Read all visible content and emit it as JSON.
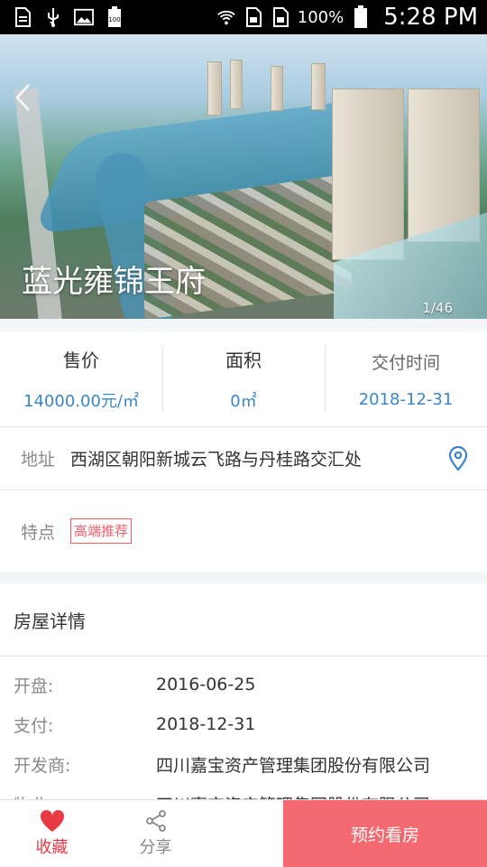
{
  "status_bar": {
    "battery_pct": "100%",
    "time": "5:28 PM",
    "battery_badge": "100",
    "icons": [
      "sim-card-icon",
      "usb-icon",
      "image-icon",
      "battery-icon",
      "wifi-icon",
      "sim-icon",
      "sim-icon",
      "battery-icon"
    ]
  },
  "hero": {
    "title": "蓝光雍锦王府",
    "counter": "1/46"
  },
  "stats": [
    {
      "label": "售价",
      "value": "14000.00元/㎡"
    },
    {
      "label": "面积",
      "value": "0㎡"
    },
    {
      "label": "交付时间",
      "value": "2018-12-31"
    }
  ],
  "address": {
    "label": "地址",
    "value": "西湖区朝阳新城云飞路与丹桂路交汇处"
  },
  "features": {
    "label": "特点",
    "tag": "高端推荐"
  },
  "details": {
    "title": "房屋详情",
    "rows": [
      {
        "label": "开盘:",
        "value": "2016-06-25"
      },
      {
        "label": "支付:",
        "value": "2018-12-31"
      },
      {
        "label": "开发商:",
        "value": "四川嘉宝资产管理集团股份有限公司"
      },
      {
        "label": "物业:",
        "value": "四川嘉宝资产管理集团股份有限公司"
      }
    ]
  },
  "bottom_bar": {
    "favorite": "收藏",
    "share": "分享",
    "book": "预约看房"
  },
  "colors": {
    "accent_blue": "#3a86c8",
    "favorite_red": "#e83a44",
    "book_button": "#f56a70",
    "tag_red": "#f25c66"
  }
}
